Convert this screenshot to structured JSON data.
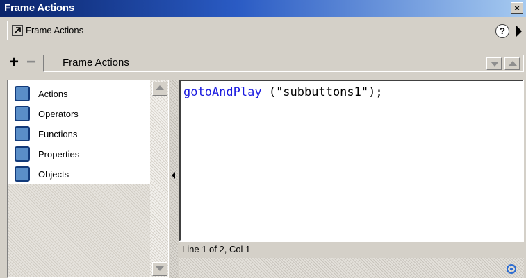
{
  "window": {
    "title": "Frame Actions",
    "close_glyph": "×"
  },
  "tab": {
    "label": "Frame Actions"
  },
  "header": {
    "help_glyph": "?"
  },
  "toolbar": {
    "add_glyph": "+",
    "remove_glyph": "−",
    "panel_title": "Frame Actions"
  },
  "toolbox": {
    "items": [
      {
        "label": "Actions",
        "icon": "book-icon"
      },
      {
        "label": "Operators",
        "icon": "book-icon"
      },
      {
        "label": "Functions",
        "icon": "book-icon"
      },
      {
        "label": "Properties",
        "icon": "book-icon"
      },
      {
        "label": "Objects",
        "icon": "book-icon"
      }
    ]
  },
  "editor": {
    "code_keyword": "gotoAndPlay",
    "code_rest": " (\"subbuttons1\");"
  },
  "status": {
    "text": "Line 1 of 2, Col 1"
  },
  "colors": {
    "keyword": "#1a1ae0",
    "titlebar_start": "#0a246a",
    "titlebar_end": "#a6caf0"
  }
}
